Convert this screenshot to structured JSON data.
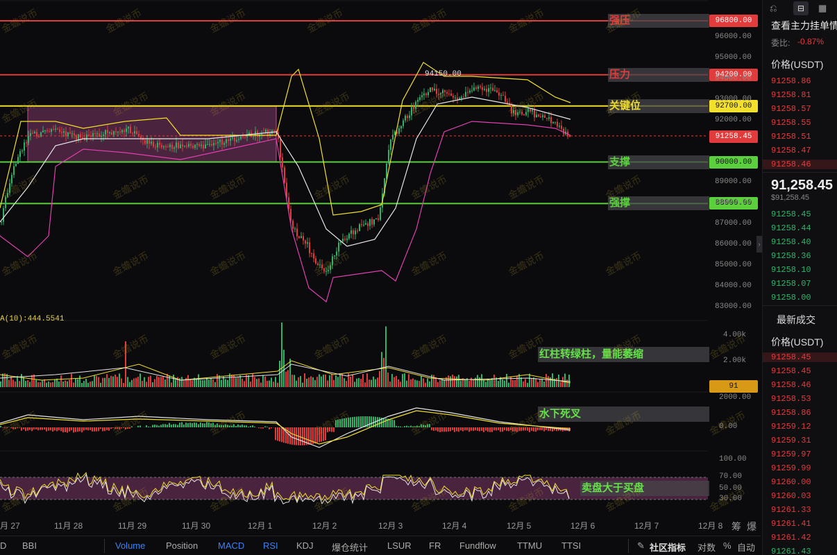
{
  "price_levels": [
    {
      "label": "强压",
      "price": 96800,
      "tag": "96800.00",
      "color": "#e23b3b",
      "tag_bg": "#e23b3b"
    },
    {
      "label": "压力",
      "price": 94200,
      "tag": "94200.00",
      "color": "#e23b3b",
      "tag_bg": "#e23b3b"
    },
    {
      "label": "关键位",
      "price": 92700,
      "tag": "92700.00",
      "color": "#f2e02c",
      "tag_bg": "#f2e02c"
    },
    {
      "label": "支撑",
      "price": 90000,
      "tag": "90000.00",
      "color": "#5ad03c",
      "tag_bg": "#5ad03c"
    },
    {
      "label": "强撑",
      "price": 88000,
      "tag": "88000.00",
      "color": "#5ad03c",
      "tag_bg": "#5ad03c"
    }
  ],
  "current_price": {
    "value": 91258.45,
    "tag": "91258.45",
    "tag_bg": "#e23b3b"
  },
  "high_marker": "94150.00",
  "price_axis": [
    "96000.00",
    "95000.00",
    "94000.00",
    "93000.00",
    "92000.00",
    "91000.00",
    "89000.00",
    "88000.00",
    "87000.00",
    "86000.00",
    "85000.00",
    "84000.00",
    "83000.00"
  ],
  "volume_axis": [
    "4.00k",
    "2.00k"
  ],
  "volume_ma_label": "A(10):444.5541",
  "volume_tag": "91",
  "macd_axis": [
    "2000.00",
    "0.00"
  ],
  "rsi_axis": [
    "100.00",
    "70.00",
    "50.00",
    "30.00"
  ],
  "annotations": {
    "volume": "红柱转绿柱，量能萎缩",
    "macd": "水下死叉",
    "rsi": "卖盘大于买盘"
  },
  "date_labels": [
    "月 27",
    "11月 28",
    "11月 29",
    "11月 30",
    "12月 1",
    "12月 2",
    "12月 3",
    "12月 4",
    "12月 5",
    "12月 6",
    "12月 7",
    "12月 8"
  ],
  "watermark": "金蟾说币",
  "toolbar_bottom": {
    "items": [
      "D",
      "BBI",
      "Volume",
      "Position",
      "MACD",
      "RSI",
      "KDJ",
      "爆仓统计",
      "LSUR",
      "FR",
      "Fundflow",
      "TTMU",
      "TTSI"
    ],
    "active": [
      "Volume",
      "MACD",
      "RSI"
    ],
    "right": [
      "社区指标",
      "对数",
      "%",
      "自动"
    ],
    "axis_corner": [
      "筹",
      "爆"
    ]
  },
  "sidebar": {
    "title": "查看主力挂单情",
    "ratio_label": "委比:",
    "ratio_value": "-0.87%",
    "price_header": "价格(USDT)",
    "asks": [
      "91258.86",
      "91258.81",
      "91258.57",
      "91258.55",
      "91258.51",
      "91258.47",
      "91258.46"
    ],
    "last_price": "91,258.45",
    "last_price_usd": "$91,258.45",
    "bids": [
      "91258.45",
      "91258.44",
      "91258.40",
      "91258.36",
      "91258.10",
      "91258.07",
      "91258.00"
    ],
    "trades_title": "最新成交",
    "trades_header": "价格(USDT)",
    "trades": [
      "91258.45",
      "91258.45",
      "91258.46",
      "91258.53",
      "91258.86",
      "91259.12",
      "91259.31",
      "91259.97",
      "91259.99",
      "91260.00",
      "91260.03",
      "91261.33",
      "91261.41",
      "91261.42",
      "91261.43"
    ],
    "trade_colors": [
      "#e23b3b",
      "#e23b3b",
      "#e23b3b",
      "#e23b3b",
      "#e23b3b",
      "#e23b3b",
      "#e23b3b",
      "#e23b3b",
      "#e23b3b",
      "#e23b3b",
      "#e23b3b",
      "#e23b3b",
      "#e23b3b",
      "#e23b3b",
      "#2fb36b"
    ]
  },
  "colors": {
    "up": "#2fb36b",
    "down": "#e23b3b",
    "bb_upper": "#f2e02c",
    "bb_mid": "#e6e6e6",
    "bb_lower": "#e040b0",
    "box": "#c0509a"
  }
}
